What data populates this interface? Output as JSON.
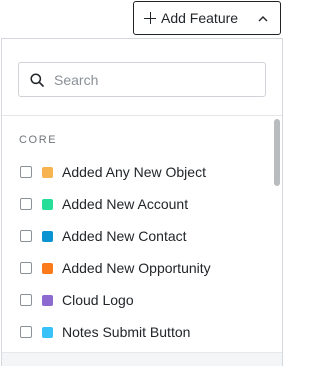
{
  "trigger": {
    "label": "Add Feature"
  },
  "search": {
    "placeholder": "Search",
    "value": ""
  },
  "section": {
    "title": "CORE"
  },
  "items": [
    {
      "label": "Added Any New Object",
      "color": "#f6b350"
    },
    {
      "label": "Added New Account",
      "color": "#26de98"
    },
    {
      "label": "Added New Contact",
      "color": "#0c93d2"
    },
    {
      "label": "Added New Opportunity",
      "color": "#fb7b1b"
    },
    {
      "label": "Cloud Logo",
      "color": "#8c6ad0"
    },
    {
      "label": "Notes Submit Button",
      "color": "#38c2f7"
    }
  ]
}
